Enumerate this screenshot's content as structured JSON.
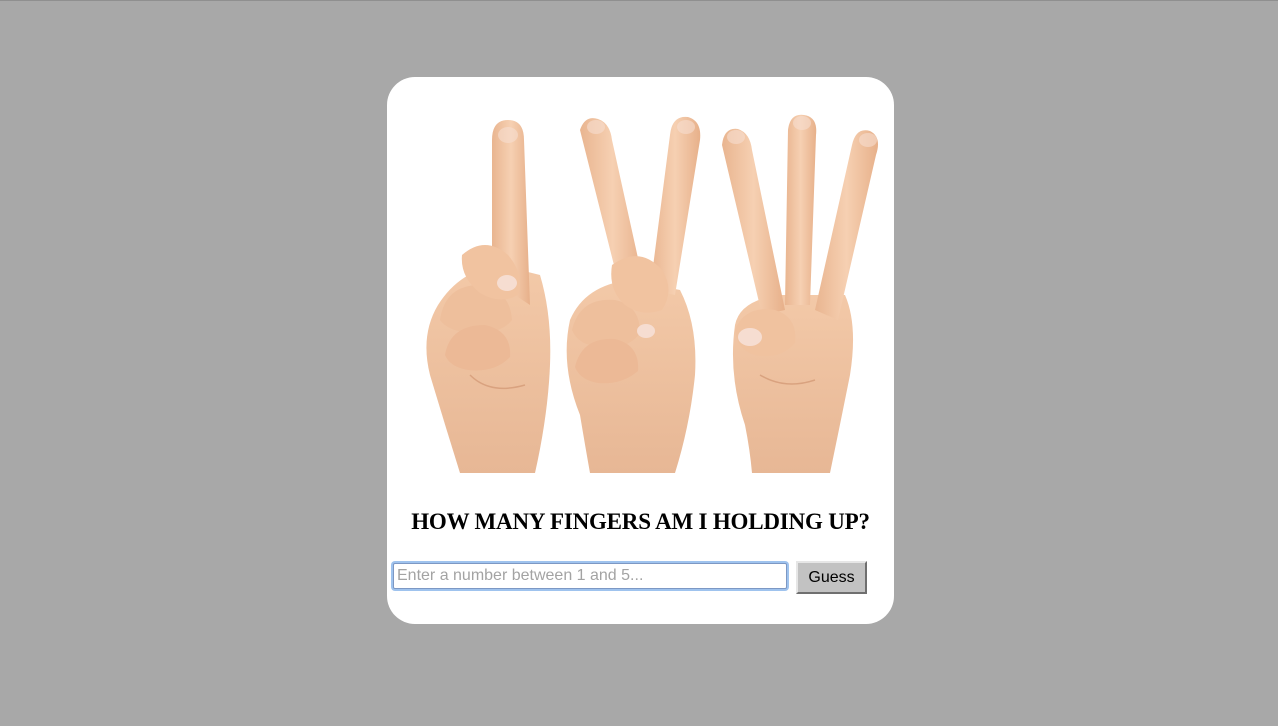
{
  "page": {
    "background_color": "#a8a8a8",
    "card_color": "#ffffff"
  },
  "image": {
    "icon": "hands-counting-one-two-three",
    "skin_color": "#f2c8a6",
    "nail_color": "#f6ddd1"
  },
  "title": "HOW MANY FINGERS AM I HOLDING UP?",
  "guess_input": {
    "value": "",
    "placeholder": "Enter a number between 1 and 5..."
  },
  "guess_button": {
    "label": "Guess"
  }
}
